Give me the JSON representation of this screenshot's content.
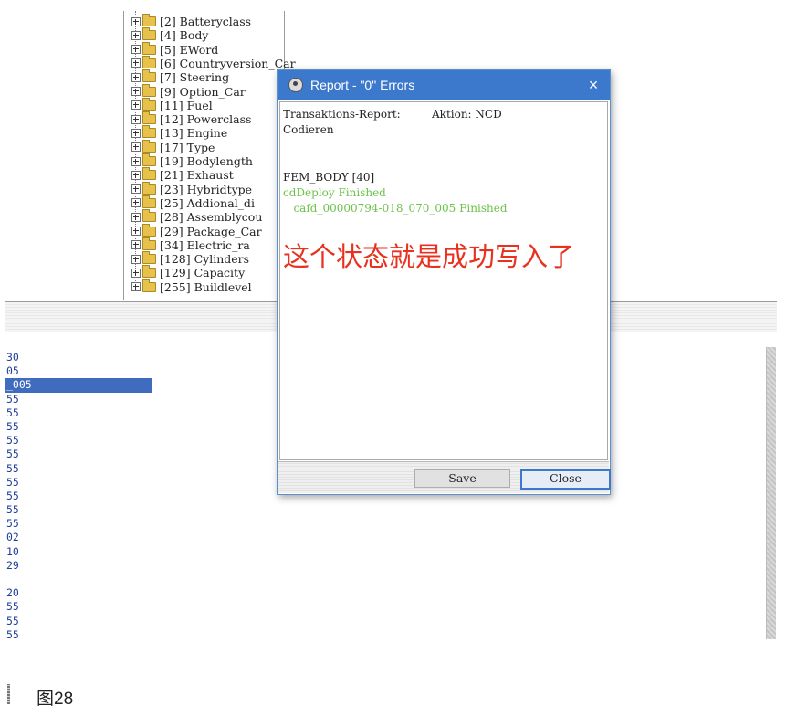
{
  "tree": {
    "items": [
      {
        "label": "[2] Batteryclass"
      },
      {
        "label": "[4] Body"
      },
      {
        "label": "[5] EWord"
      },
      {
        "label": "[6] Countryversion_Car"
      },
      {
        "label": "[7] Steering"
      },
      {
        "label": "[9] Option_Car"
      },
      {
        "label": "[11] Fuel"
      },
      {
        "label": "[12] Powerclass"
      },
      {
        "label": "[13] Engine"
      },
      {
        "label": "[17] Type"
      },
      {
        "label": "[19] Bodylength"
      },
      {
        "label": "[21] Exhaust"
      },
      {
        "label": "[23] Hybridtype"
      },
      {
        "label": "[25] Addional_di"
      },
      {
        "label": "[28] Assemblycou"
      },
      {
        "label": "[29] Package_Car"
      },
      {
        "label": "[34] Electric_ra"
      },
      {
        "label": "[128] Cylinders"
      },
      {
        "label": "[129] Capacity"
      },
      {
        "label": "[255] Buildlevel"
      }
    ]
  },
  "lower_list": {
    "rows": [
      "30",
      "05",
      "_005",
      "55",
      "55",
      "55",
      "55",
      "55",
      "55",
      "55",
      "55",
      "55",
      "55",
      "02",
      "10",
      "29",
      "",
      "20",
      "55",
      "55",
      "55"
    ],
    "selected_index": 2
  },
  "dialog": {
    "title": "Report - \"0\" Errors",
    "close_glyph": "×",
    "report_lines": [
      {
        "text": "Transaktions-Report:         Aktion: NCD",
        "color": "black"
      },
      {
        "text": "Codieren",
        "color": "black"
      },
      {
        "text": "",
        "color": "black"
      },
      {
        "text": "",
        "color": "black"
      },
      {
        "text": "FEM_BODY [40]",
        "color": "black"
      },
      {
        "text": "cdDeploy Finished",
        "color": "green"
      },
      {
        "text": "   cafd_00000794-018_070_005 Finished",
        "color": "green"
      }
    ],
    "annotation": "这个状态就是成功写入了",
    "annotation_color": "#e8321f",
    "save_label": "Save",
    "close_label": "Close"
  },
  "caption": {
    "text": "图28"
  }
}
